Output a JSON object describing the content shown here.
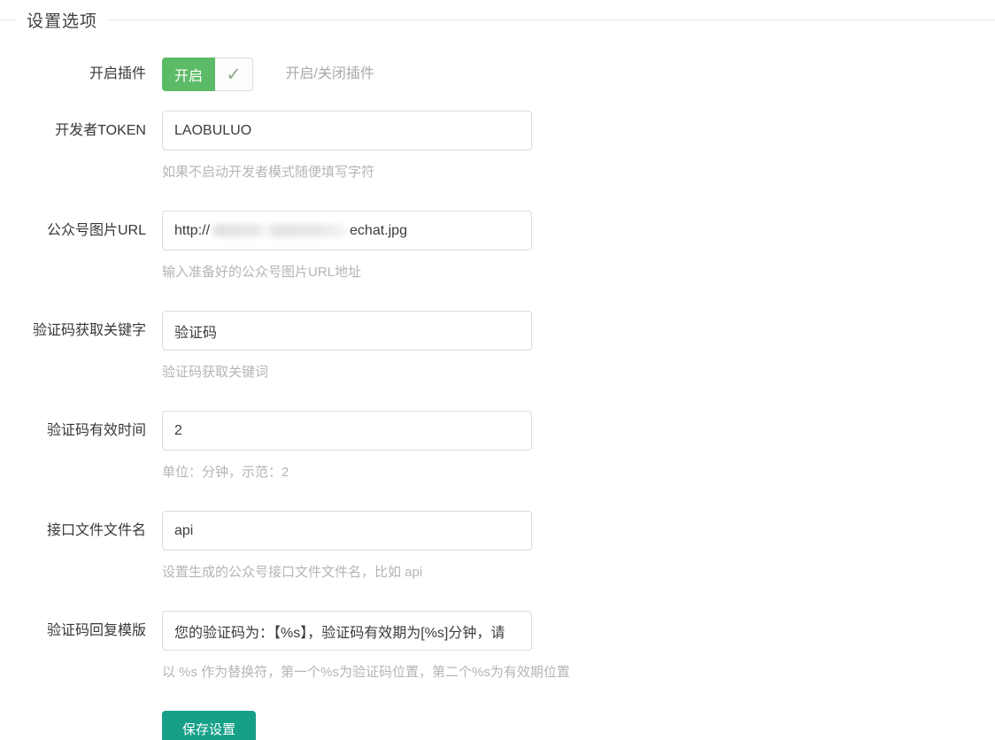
{
  "page": {
    "title": "设置选项"
  },
  "colors": {
    "toggle_on_green": "#5cbb66",
    "save_button_teal": "#17a088",
    "hint_gray": "#b5b5b5",
    "input_border": "#dcdcdc"
  },
  "icons": {
    "check_glyph": "✓"
  },
  "form": {
    "fields": [
      {
        "id": "enable_plugin",
        "label": "开启插件",
        "type": "toggle",
        "value": "开启",
        "hint": "开启/关闭插件"
      },
      {
        "id": "developer_token",
        "label": "开发者TOKEN",
        "type": "text",
        "value": "LAOBULUO",
        "hint": "如果不启动开发者模式随便填写字符"
      },
      {
        "id": "official_account_image_url",
        "label": "公众号图片URL",
        "type": "text-redacted",
        "value_prefix": "http://",
        "value_redacted": "(模糊处理)",
        "value_suffix": "echat.jpg",
        "hint": "输入准备好的公众号图片URL地址"
      },
      {
        "id": "captcha_keyword",
        "label": "验证码获取关键字",
        "type": "text",
        "value": "验证码",
        "hint": "验证码获取关键词"
      },
      {
        "id": "captcha_valid_time",
        "label": "验证码有效时间",
        "type": "text",
        "value": "2",
        "hint": "单位：分钟，示范：2"
      },
      {
        "id": "api_filename",
        "label": "接口文件文件名",
        "type": "text",
        "value": "api",
        "hint": "设置生成的公众号接口文件文件名，比如 api"
      },
      {
        "id": "captcha_reply_template",
        "label": "验证码回复模版",
        "type": "text",
        "value": "您的验证码为：【%s】，验证码有效期为[%s]分钟，请",
        "hint": "以 %s 作为替换符，第一个%s为验证码位置，第二个%s为有效期位置"
      }
    ],
    "save_button": {
      "label": "保存设置"
    }
  }
}
